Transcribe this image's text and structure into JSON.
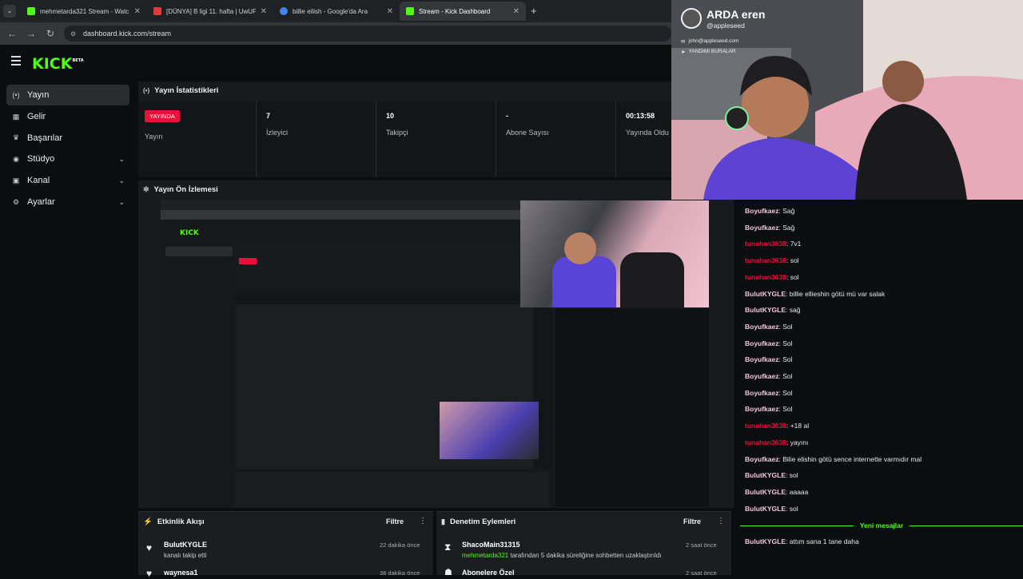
{
  "browser": {
    "tabs": [
      {
        "title": "mehmetarda321 Stream - Watc",
        "color": "#53fc18"
      },
      {
        "title": "[DÜNYA] B ligi 11. hafta | UwUF",
        "color": "#e23b3b"
      },
      {
        "title": "billie eilish - Google'da Ara",
        "color": "#4285f4"
      },
      {
        "title": "Stream - Kick Dashboard",
        "color": "#53fc18"
      }
    ],
    "url": "dashboard.kick.com/stream"
  },
  "logo": {
    "text": "KICK",
    "badge": "BETA"
  },
  "sidebar": {
    "items": [
      {
        "label": "Yayın",
        "icon": "broadcast-icon",
        "glyph": "(•)",
        "selected": true,
        "chevron": false
      },
      {
        "label": "Gelir",
        "icon": "revenue-icon",
        "glyph": "▦",
        "selected": false,
        "chevron": false
      },
      {
        "label": "Başarılar",
        "icon": "trophy-icon",
        "glyph": "🏆",
        "selected": false,
        "chevron": false
      },
      {
        "label": "Stüdyo",
        "icon": "studio-icon",
        "glyph": "◉",
        "selected": false,
        "chevron": true
      },
      {
        "label": "Kanal",
        "icon": "channel-icon",
        "glyph": "▣",
        "selected": false,
        "chevron": true
      },
      {
        "label": "Ayarlar",
        "icon": "settings-icon",
        "glyph": "⚙",
        "selected": false,
        "chevron": true
      }
    ]
  },
  "stats": {
    "title": "Yayın İstatistikleri",
    "live_badge": "YAYINDA",
    "cells": [
      {
        "value": "",
        "label": "Yayın"
      },
      {
        "value": "7",
        "label": "İzleyici"
      },
      {
        "value": "10",
        "label": "Takipçi"
      },
      {
        "value": "-",
        "label": "Abone Sayısı"
      },
      {
        "value": "00:13:58",
        "label": "Yayında Oldu"
      }
    ]
  },
  "preview": {
    "title": "Yayın Ön İzlemesi"
  },
  "camera": {
    "name": "ARDA eren",
    "handle": "@appleseed",
    "email": "john@appleseed.com",
    "location": "YANDIMI BURALAR"
  },
  "chat": {
    "lines": [
      {
        "user": "Boyufkaez",
        "msg": "Sağ",
        "color": "#f0c8d8"
      },
      {
        "user": "Boyufkaez",
        "msg": "Sağ",
        "color": "#f0c8d8"
      },
      {
        "user": "tunahan3638",
        "msg": "7v1",
        "color": "#e9113c"
      },
      {
        "user": "tunahan3638",
        "msg": "sol",
        "color": "#e9113c"
      },
      {
        "user": "tunahan3638",
        "msg": "sol",
        "color": "#e9113c"
      },
      {
        "user": "BulutKYGLE",
        "msg": "billie ellieshin götü mü var salak",
        "color": "#f0c8d8"
      },
      {
        "user": "BulutKYGLE",
        "msg": "sağ",
        "color": "#f0c8d8"
      },
      {
        "user": "Boyufkaez",
        "msg": "Sol",
        "color": "#f0c8d8"
      },
      {
        "user": "Boyufkaez",
        "msg": "Sol",
        "color": "#f0c8d8"
      },
      {
        "user": "Boyufkaez",
        "msg": "Sol",
        "color": "#f0c8d8"
      },
      {
        "user": "Boyufkaez",
        "msg": "Sol",
        "color": "#f0c8d8"
      },
      {
        "user": "Boyufkaez",
        "msg": "Sol",
        "color": "#f0c8d8"
      },
      {
        "user": "Boyufkaez",
        "msg": "Sol",
        "color": "#f0c8d8"
      },
      {
        "user": "tunahan3638",
        "msg": "+18 al",
        "color": "#e9113c"
      },
      {
        "user": "tunahan3638",
        "msg": "yayını",
        "color": "#e9113c"
      },
      {
        "user": "Boyufkaez",
        "msg": "Bilie elishin götü sence internette varmıdır mal",
        "color": "#f0c8d8"
      },
      {
        "user": "BulutKYGLE",
        "msg": "sol",
        "color": "#f0c8d8"
      },
      {
        "user": "BulutKYGLE",
        "msg": "aaaaa",
        "color": "#f0c8d8"
      },
      {
        "user": "BulutKYGLE",
        "msg": "sol",
        "color": "#f0c8d8"
      }
    ],
    "new_messages": "Yeni mesajlar",
    "after": {
      "user": "BulutKYGLE",
      "msg": "attım sana 1 tane daha",
      "color": "#f0c8d8"
    }
  },
  "activity": {
    "title": "Etkinlik Akışı",
    "filter": "Filtre",
    "items": [
      {
        "name": "BulutKYGLE",
        "desc": "kanalı takip etti",
        "time": "22 dakika önce"
      },
      {
        "name": "waynesa1",
        "desc": "",
        "time": "38 dakika önce"
      }
    ]
  },
  "moderation": {
    "title": "Denetim Eylemleri",
    "filter": "Filtre",
    "items": [
      {
        "name": "ShacoMain31315",
        "actor": "mehmetarda321",
        "desc": "tarafından 5 dakika süreliğine sohbetten uzaklaştırıldı",
        "time": "2 saat önce"
      },
      {
        "name": "Abonelere Özel",
        "actor": "",
        "desc": "",
        "time": "2 saat önce"
      }
    ]
  }
}
